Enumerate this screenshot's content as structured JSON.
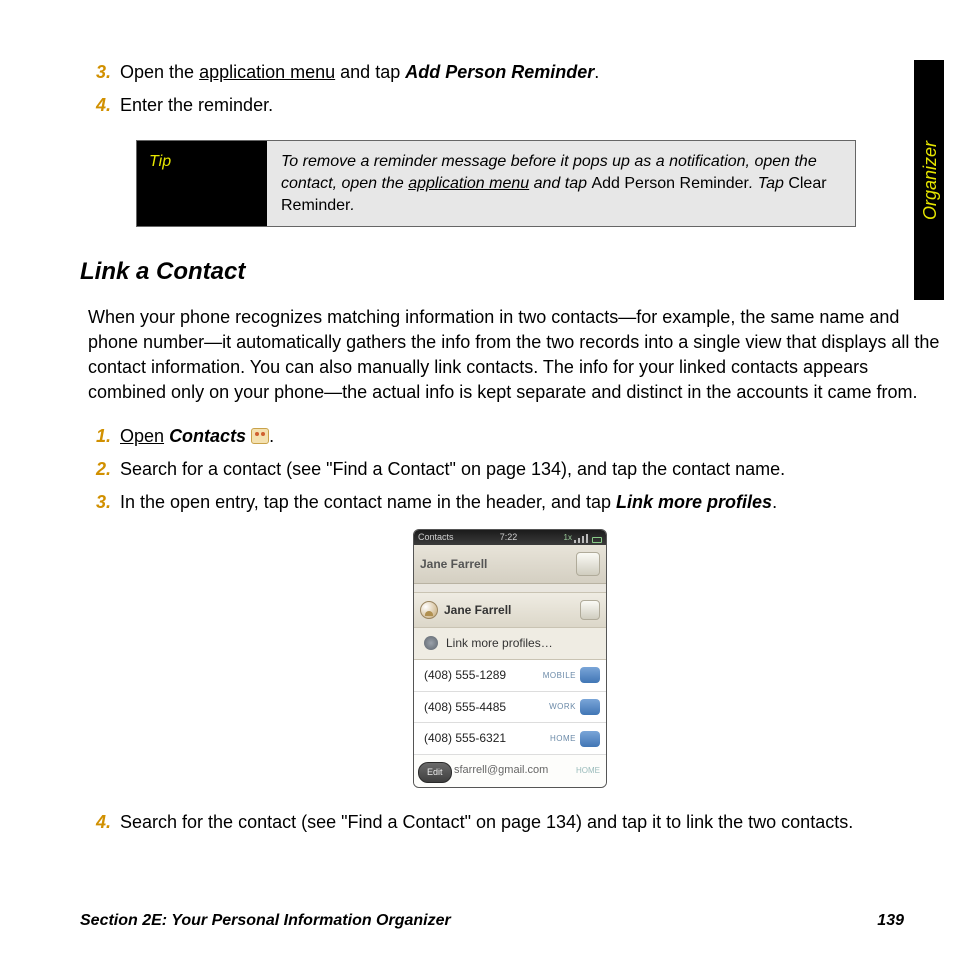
{
  "side_tab": "Organizer",
  "top_list": {
    "item3": {
      "num": "3.",
      "pre": "Open the ",
      "link": "application menu",
      "mid": " and tap ",
      "bold": "Add Person Reminder",
      "post": "."
    },
    "item4": {
      "num": "4.",
      "text": "Enter the reminder."
    }
  },
  "tip": {
    "label": "Tip",
    "t1": "To remove a reminder message before it pops up as a notification, open the contact, open the ",
    "link": "application menu",
    "t2": "  and tap ",
    "b1": "Add Person Reminder",
    "t3": ". Tap ",
    "b2": "Clear Reminder",
    "t4": "."
  },
  "heading": "Link a Contact",
  "para": "When your phone recognizes matching information in two contacts—for example, the same name and phone number—it automatically gathers the info from the two records into a single view that displays all the contact information. You can also manually link contacts. The info for your linked contacts appears combined only on your phone—the actual info is kept separate and distinct in the accounts it came from.",
  "steps": {
    "s1": {
      "num": "1.",
      "link": "Open",
      "space": " ",
      "bold": "Contacts",
      "post": " ",
      "after_icon": "."
    },
    "s2": {
      "num": "2.",
      "text": "Search for a contact (see \"Find a Contact\" on page 134), and tap the contact name."
    },
    "s3": {
      "num": "3.",
      "pre": "In the open entry, tap the contact name in the header, and tap ",
      "bold": "Link more profiles",
      "post": "."
    },
    "s4": {
      "num": "4.",
      "text": "Search for the contact (see \"Find a Contact\" on page 134) and tap it to link the two contacts."
    }
  },
  "phone": {
    "status_left": "Contacts",
    "status_time": "7:22",
    "header_name": "Jane Farrell",
    "profile_name": "Jane Farrell",
    "link_label": "Link more profiles…",
    "rows": [
      {
        "num": "(408) 555-1289",
        "type": "MOBILE"
      },
      {
        "num": "(408) 555-4485",
        "type": "WORK"
      },
      {
        "num": "(408) 555-6321",
        "type": "HOME"
      }
    ],
    "email": "sfarrell@gmail.com",
    "email_type": "HOME",
    "edit": "Edit"
  },
  "footer": {
    "section": "Section 2E: Your Personal Information Organizer",
    "page": "139"
  }
}
